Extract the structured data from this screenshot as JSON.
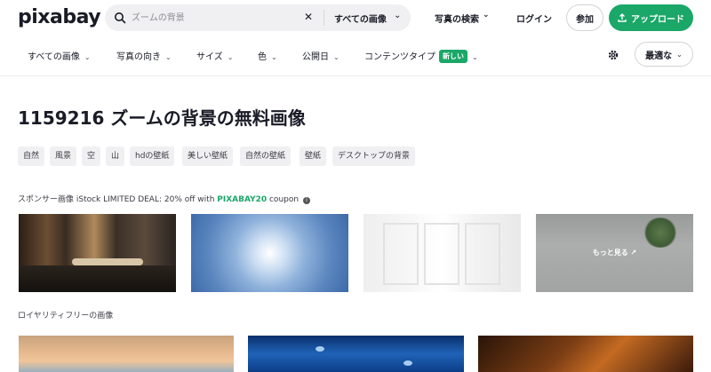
{
  "header": {
    "logo": "pixabay",
    "search_placeholder": "ズームの背景",
    "search_scope": "すべての画像",
    "explore_label": "写真の検索",
    "login_label": "ログイン",
    "join_label": "参加",
    "upload_label": "アップロード"
  },
  "filters": {
    "items": [
      {
        "label": "すべての画像"
      },
      {
        "label": "写真の向き"
      },
      {
        "label": "サイズ"
      },
      {
        "label": "色"
      },
      {
        "label": "公開日"
      },
      {
        "label": "コンテンツタイプ"
      }
    ],
    "new_badge": "新しい",
    "sort_label": "最適な"
  },
  "page_title": "1159216 ズームの背景の無料画像",
  "tags": [
    "自然",
    "風景",
    "空",
    "山",
    "hdの壁紙",
    "美しい壁紙",
    "自然の壁紙",
    "壁紙",
    "デスクトップの背景"
  ],
  "sponsor": {
    "prefix": "スポンサー画像 iStock LIMITED DEAL: 20% off with ",
    "code": "PIXABAY20",
    "suffix": " coupon",
    "more_label": "もっと見る"
  },
  "royalty_label": "ロイヤリティフリーの画像",
  "colors": {
    "accent": "#1aa768",
    "text": "#191b26",
    "chip_bg": "#f0f0f2"
  }
}
